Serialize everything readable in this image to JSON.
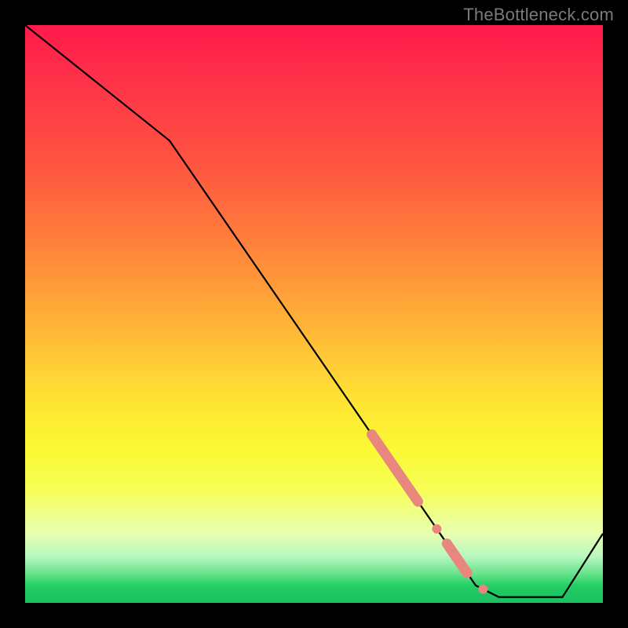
{
  "watermark": "TheBottleneck.com",
  "chart_data": {
    "type": "line",
    "title": "",
    "xlabel": "",
    "ylabel": "",
    "xlim": [
      0,
      100
    ],
    "ylim": [
      0,
      100
    ],
    "background_gradient": {
      "top": "#ff1a4b",
      "mid": "#ffe034",
      "bottom": "#1bc05f"
    },
    "series": [
      {
        "name": "curve",
        "color": "#000000",
        "x": [
          0,
          25,
          78,
          82,
          93,
          100
        ],
        "values": [
          100,
          80,
          3,
          1,
          1,
          12
        ]
      }
    ],
    "markers": {
      "name": "highlight-range",
      "color": "#e9867e",
      "along_series": "curve",
      "segments": [
        {
          "x_start": 60,
          "x_end": 68,
          "style": "thick"
        },
        {
          "x_start": 71,
          "x_end": 71.5,
          "style": "dot"
        },
        {
          "x_start": 73,
          "x_end": 76.5,
          "style": "thick"
        },
        {
          "x_start": 79,
          "x_end": 79.5,
          "style": "dot"
        }
      ]
    }
  }
}
